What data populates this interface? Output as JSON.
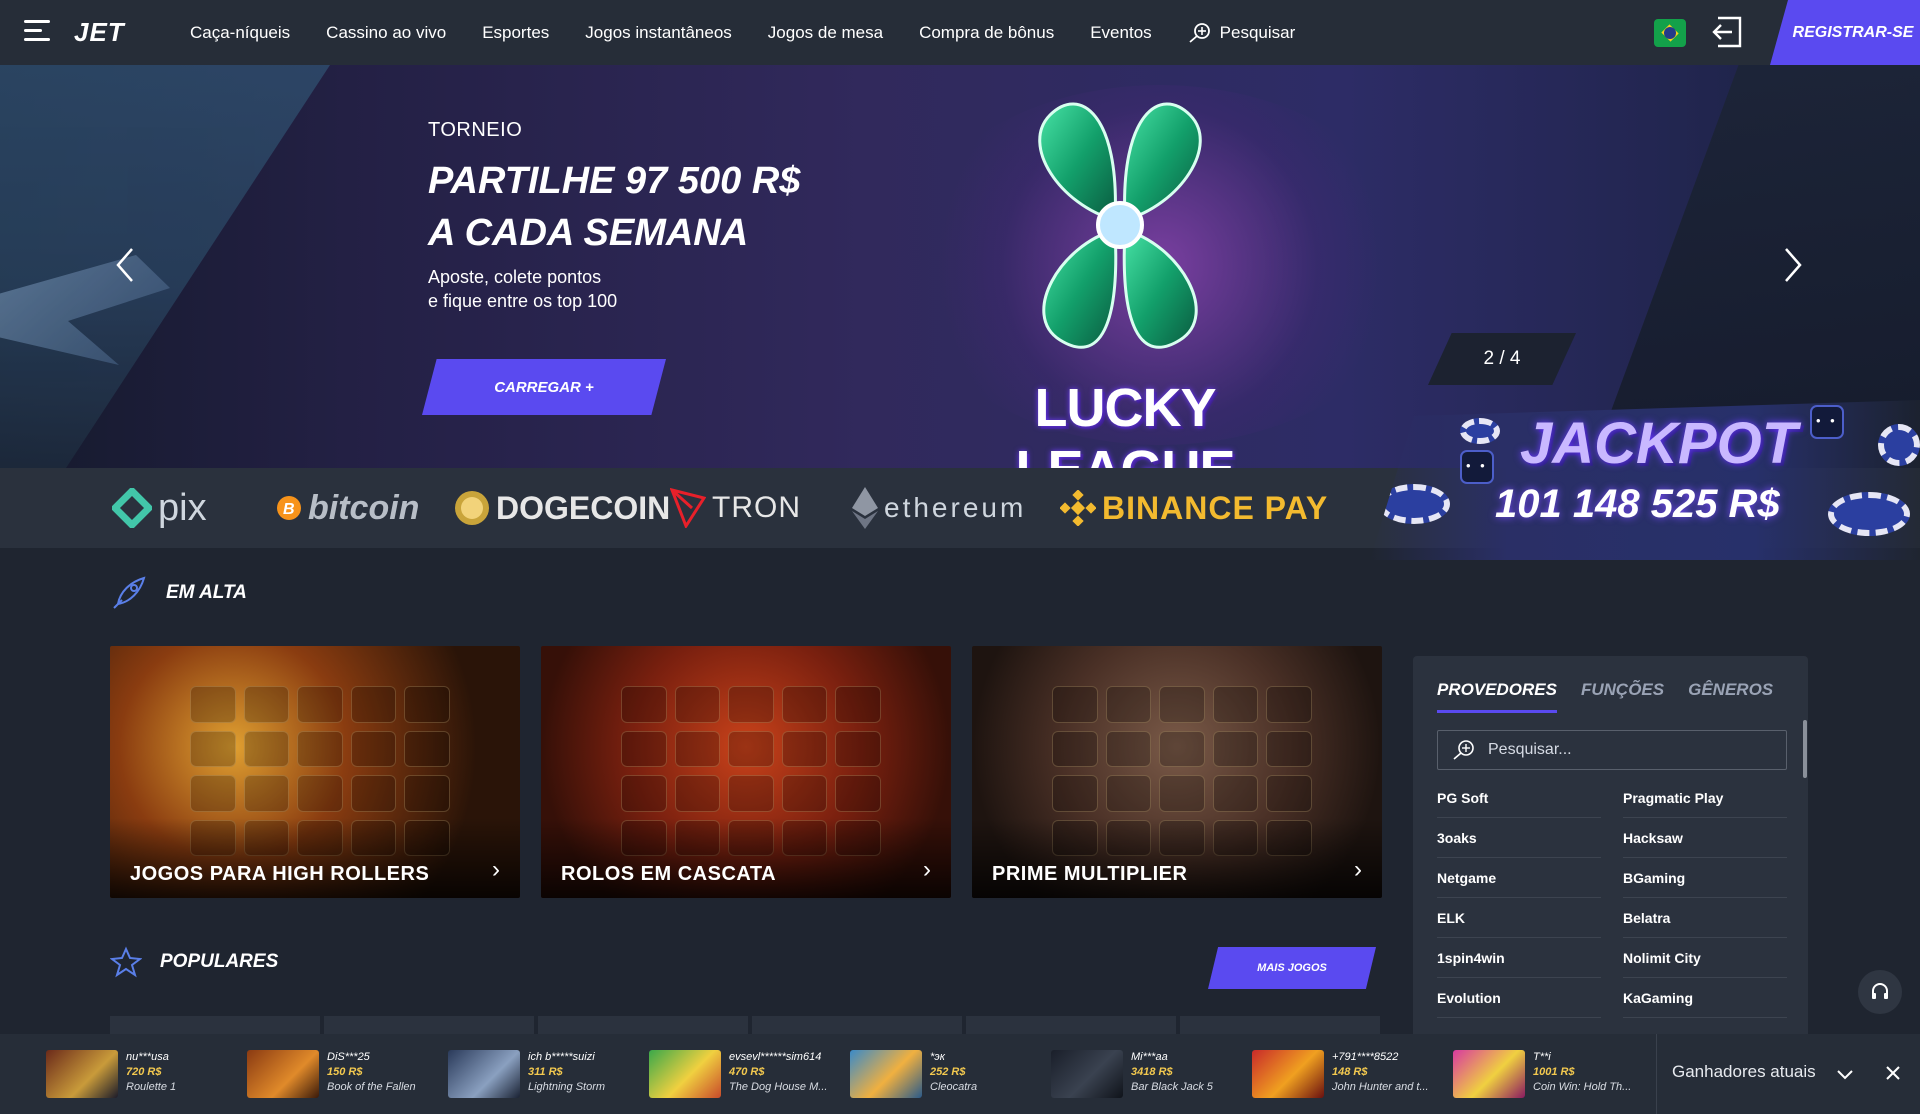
{
  "header": {
    "logo": "JET",
    "nav": [
      "Caça-níqueis",
      "Cassino ao vivo",
      "Esportes",
      "Jogos instantâneos",
      "Jogos de mesa",
      "Compra de bônus",
      "Eventos"
    ],
    "search_label": "Pesquisar",
    "register_label": "REGISTRAR-SE"
  },
  "hero": {
    "kicker": "TORNEIO",
    "title_line1": "PARTILHE 97 500 R$",
    "title_line2": "A CADA SEMANA",
    "subtitle_line1": "Aposte, colete pontos",
    "subtitle_line2": "e fique entre os top 100",
    "cta": "CARREGAR +",
    "brand": "LUCKY LEAGUE",
    "slide_counter": "2 / 4"
  },
  "payments": [
    "pix",
    "bitcoin",
    "DOGECOIN",
    "TRON",
    "ethereum",
    "BINANCE PAY"
  ],
  "jackpot": {
    "title": "JACKPOT",
    "amount": "101 148 525 R$"
  },
  "trending": {
    "title": "EM ALTA",
    "cards": [
      "JOGOS PARA HIGH ROLLERS",
      "ROLOS EM CASCATA",
      "PRIME MULTIPLIER"
    ]
  },
  "popular": {
    "title": "POPULARES",
    "more_games": "MAIS JOGOS"
  },
  "filter": {
    "tabs": [
      "PROVEDORES",
      "FUNÇÕES",
      "GÊNEROS"
    ],
    "search_placeholder": "Pesquisar...",
    "providers": [
      "PG Soft",
      "Pragmatic Play",
      "3oaks",
      "Hacksaw",
      "Netgame",
      "BGaming",
      "ELK",
      "Belatra",
      "1spin4win",
      "Nolimit City",
      "Evolution",
      "KaGaming"
    ]
  },
  "winners": {
    "label": "Ganhadores atuais",
    "items": [
      {
        "user": "nu***usa",
        "amount": "720 R$",
        "game": "Roulette 1"
      },
      {
        "user": "DiS***25",
        "amount": "150 R$",
        "game": "Book of the Fallen"
      },
      {
        "user": "ich b*****suizi",
        "amount": "311 R$",
        "game": "Lightning Storm"
      },
      {
        "user": "evsevl******sim614",
        "amount": "470 R$",
        "game": "The Dog House M..."
      },
      {
        "user": "*эк",
        "amount": "252 R$",
        "game": "Cleocatra"
      },
      {
        "user": "Mi***aa",
        "amount": "3418 R$",
        "game": "Bar Black Jack 5"
      },
      {
        "user": "+791****8522",
        "amount": "148 R$",
        "game": "John Hunter and t..."
      },
      {
        "user": "T**i",
        "amount": "1001 R$",
        "game": "Coin Win: Hold Th..."
      }
    ]
  },
  "colors": {
    "accent": "#5a4af0",
    "background": "#1f2530",
    "header": "#262d38",
    "panel": "#2b323e",
    "win_amount": "#f3c94f",
    "binance": "#f3ba2f"
  },
  "icons": [
    "menu-icon",
    "search-icon",
    "brazil-flag-icon",
    "login-icon",
    "chevron-left-icon",
    "chevron-right-icon",
    "rocket-icon",
    "star-icon",
    "headset-icon",
    "chevron-down-icon",
    "close-icon"
  ]
}
